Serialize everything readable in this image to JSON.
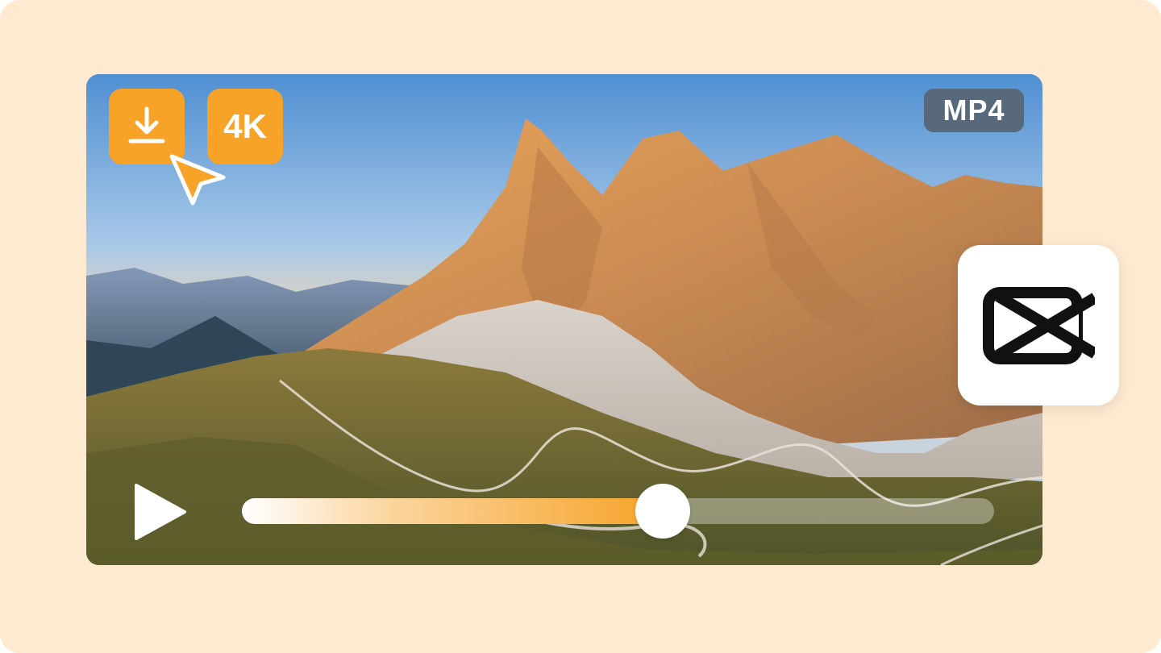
{
  "badges": {
    "format_label": "MP4",
    "resolution_label": "4K"
  },
  "icons": {
    "download": "download-icon",
    "cursor": "cursor-arrow-icon",
    "play": "play-icon",
    "logo": "capcut-logo"
  },
  "player": {
    "progress_fraction": 0.56
  },
  "colors": {
    "page_background": "#feead0",
    "accent": "#f7a328",
    "badge_background": "#59697c",
    "logo_black": "#111111"
  }
}
